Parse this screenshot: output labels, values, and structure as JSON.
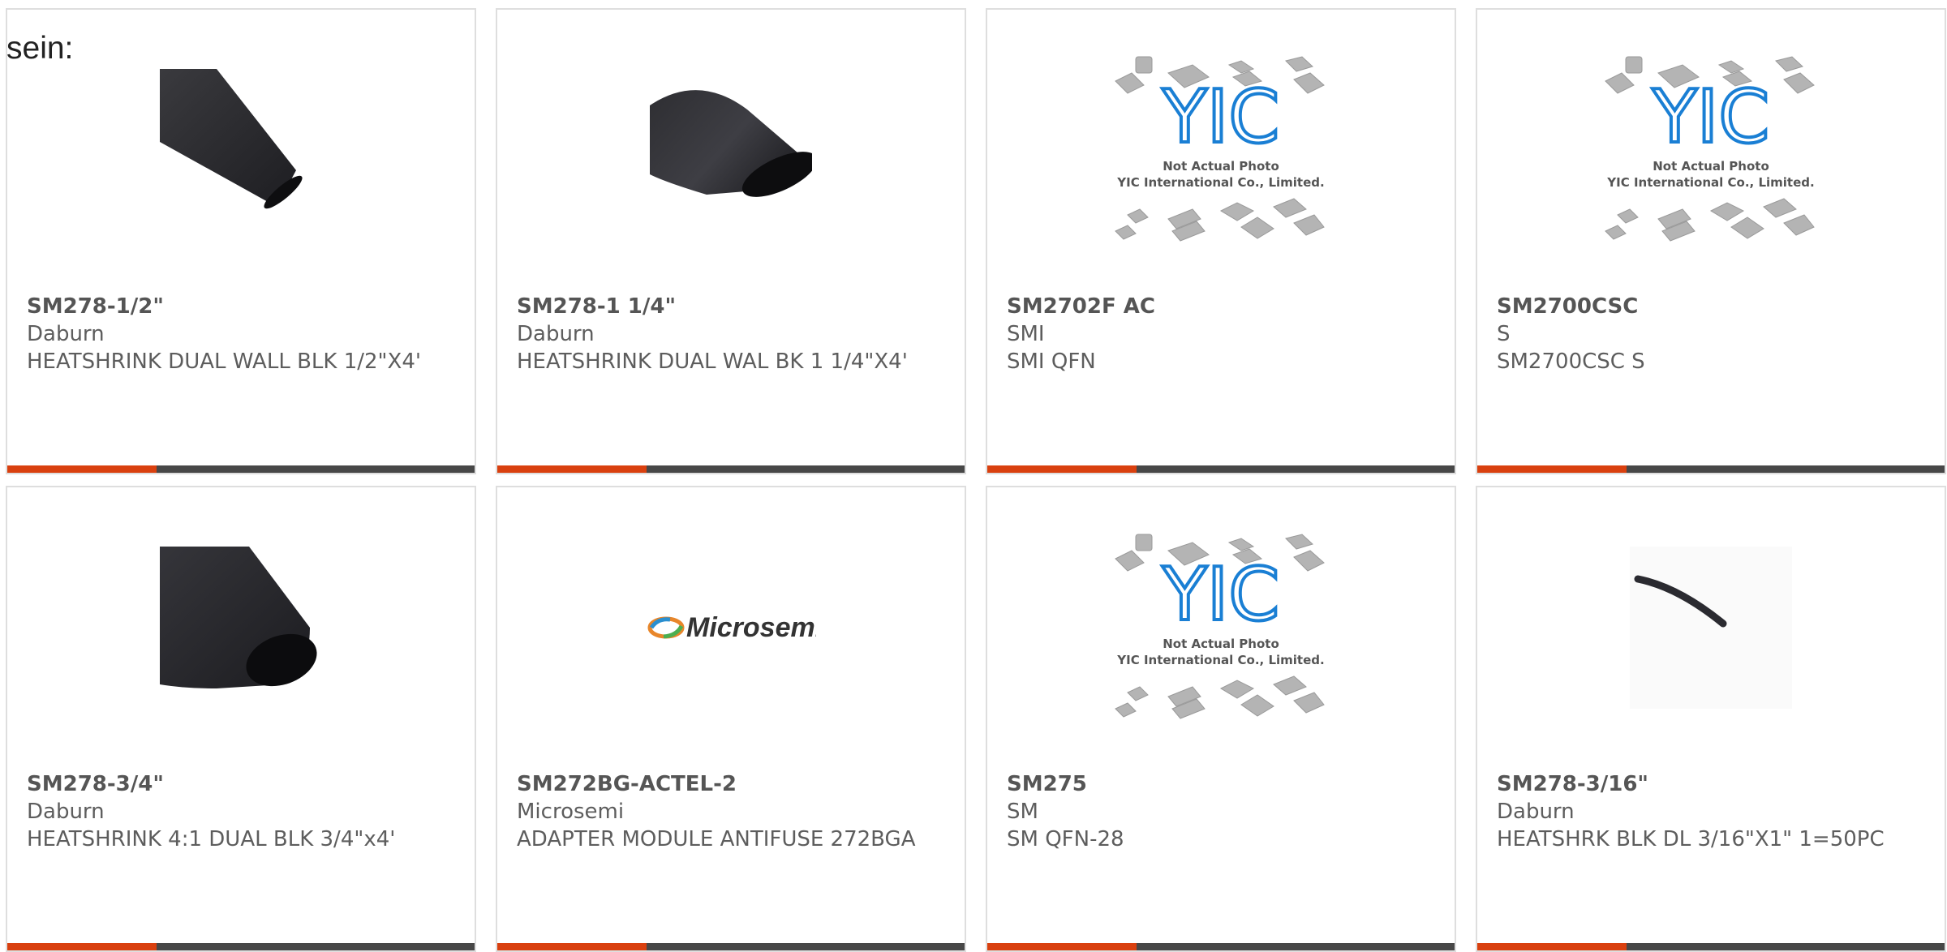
{
  "stray_text": "sein:",
  "accent_color": "#d9400f",
  "bar_color": "#474747",
  "products": [
    {
      "part_number": "SM278-1/2\"",
      "manufacturer": "Daburn",
      "description": "HEATSHRINK DUAL WALL BLK 1/2\"X4'",
      "image": "heatshrink-tube-diagonal"
    },
    {
      "part_number": "SM278-1 1/4\"",
      "manufacturer": "Daburn",
      "description": "HEATSHRINK DUAL WAL BK 1 1/4\"X4'",
      "image": "heatshrink-tube-wide"
    },
    {
      "part_number": "SM2702F AC",
      "manufacturer": "SMI",
      "description": "SMI QFN",
      "image": "placeholder-not-actual-photo"
    },
    {
      "part_number": "SM2700CSC",
      "manufacturer": "S",
      "description": "SM2700CSC S",
      "image": "placeholder-not-actual-photo"
    },
    {
      "part_number": "SM278-3/4\"",
      "manufacturer": "Daburn",
      "description": "HEATSHRINK 4:1 DUAL BLK 3/4\"x4'",
      "image": "heatshrink-tube-wide"
    },
    {
      "part_number": "SM272BG-ACTEL-2",
      "manufacturer": "Microsemi",
      "description": "ADAPTER MODULE ANTIFUSE 272BGA",
      "image": "microsemi-logo"
    },
    {
      "part_number": "SM275",
      "manufacturer": "SM",
      "description": "SM QFN-28",
      "image": "placeholder-not-actual-photo"
    },
    {
      "part_number": "SM278-3/16\"",
      "manufacturer": "Daburn",
      "description": "HEATSHRK BLK DL 3/16\"X1\" 1=50PC",
      "image": "heatshrink-thin-tube"
    }
  ],
  "placeholder": {
    "logo_text": "YIC",
    "line1": "Not Actual Photo",
    "line2": "YIC International Co., Limited."
  },
  "microsemi_logo_text": "Microsemi"
}
